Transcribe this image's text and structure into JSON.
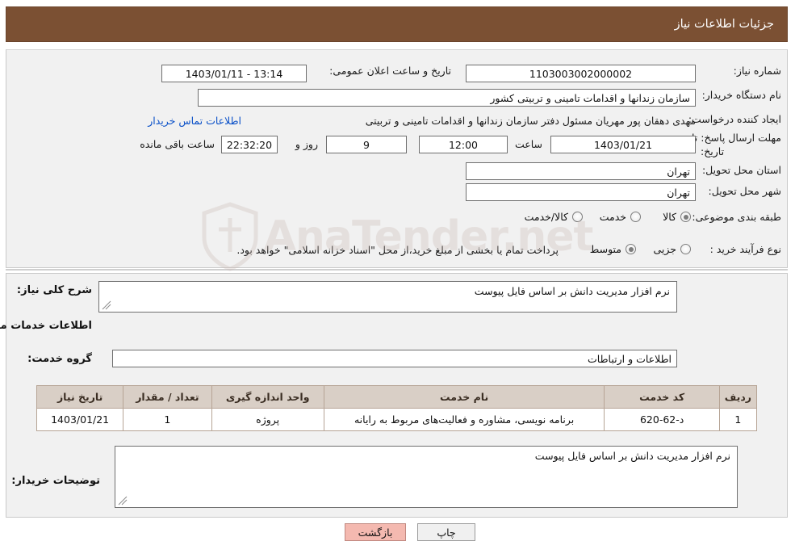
{
  "header": {
    "title": "جزئیات اطلاعات نیاز"
  },
  "form": {
    "need_number": {
      "label": "شماره نیاز:",
      "value": "1103003002000002"
    },
    "announce_datetime": {
      "label": "تاریخ و ساعت اعلان عمومی:",
      "value": "13:14 - 1403/01/11"
    },
    "buyer_org": {
      "label": "نام دستگاه خریدار:",
      "value": "سازمان زندانها و اقدامات تامینی و تربیتی کشور"
    },
    "requester": {
      "label": "ایجاد کننده درخواست:",
      "value": "مهدی  دهقان پور مهریان مسئول دفتر سازمان زندانها و اقدامات تامینی و تربیتی"
    },
    "buyer_contact_link": "اطلاعات تماس خریدار",
    "deadline": {
      "label_line1": "مهلت ارسال پاسخ: تا",
      "label_line2": "تاریخ:",
      "date_value": "1403/01/21",
      "time_label": "ساعت",
      "time_value": "12:00",
      "days_value": "9",
      "days_label": "روز و",
      "countdown_value": "22:32:20",
      "remaining_label": "ساعت باقی مانده"
    },
    "delivery_province": {
      "label": "استان محل تحویل:",
      "value": "تهران"
    },
    "delivery_city": {
      "label": "شهر محل تحویل:",
      "value": "تهران"
    },
    "category": {
      "label": "طبقه بندی موضوعی:",
      "options": [
        {
          "label": "کالا",
          "checked": true
        },
        {
          "label": "خدمت",
          "checked": false
        },
        {
          "label": "کالا/خدمت",
          "checked": false
        }
      ]
    },
    "purchase_type": {
      "label": "نوع فرآیند خرید :",
      "options": [
        {
          "label": "جزیی",
          "checked": false
        },
        {
          "label": "متوسط",
          "checked": true
        }
      ],
      "note": "پرداخت تمام یا بخشی از مبلغ خرید،از محل \"اسناد خزانه اسلامی\" خواهد بود."
    }
  },
  "sections": {
    "general_desc": {
      "label": "شرح کلی نیاز:",
      "value": "نرم افزار مدیریت دانش بر اساس فایل پیوست"
    },
    "services_info_title": "اطلاعات خدمات مورد نیاز",
    "service_group": {
      "label": "گروه خدمت:",
      "value": "اطلاعات و ارتباطات"
    },
    "buyer_notes": {
      "label": "توضیحات خریدار:",
      "value": "نرم افزار مدیریت دانش بر اساس فایل پیوست"
    }
  },
  "table": {
    "columns": [
      "ردیف",
      "کد خدمت",
      "نام خدمت",
      "واحد اندازه گیری",
      "تعداد / مقدار",
      "تاریخ نیاز"
    ],
    "rows": [
      {
        "index": "1",
        "code": "د-62-620",
        "name": "برنامه نویسی، مشاوره و فعالیت‌های مربوط به رایانه",
        "unit": "پروژه",
        "qty": "1",
        "date": "1403/01/21"
      }
    ]
  },
  "buttons": {
    "print": "چاپ",
    "back": "بازگشت"
  },
  "watermark": {
    "text": "AnaTender.net"
  },
  "colors": {
    "header_bg": "#7b5033",
    "panel_bg": "#f1f1f1",
    "table_header_bg": "#d9cfc6",
    "link": "#0a50c8",
    "back_button_bg": "#f4b9b0"
  }
}
